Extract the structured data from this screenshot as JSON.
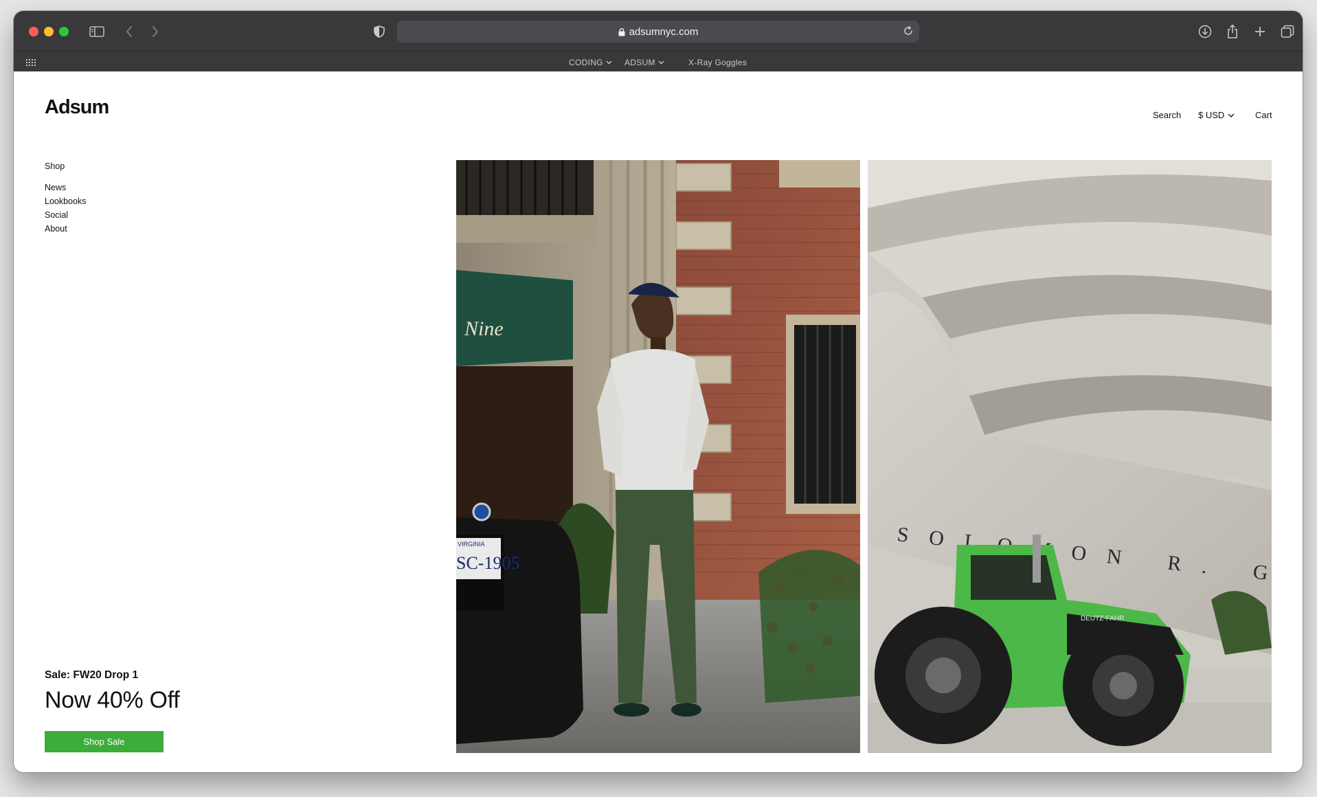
{
  "browser": {
    "url": "adsumnyc.com",
    "favorites": [
      {
        "label": "CODING",
        "has_menu": true
      },
      {
        "label": "ADSUM",
        "has_menu": true
      },
      {
        "label": "X-Ray Goggles",
        "has_menu": false
      }
    ]
  },
  "site": {
    "logo": "Adsum",
    "header": {
      "search": "Search",
      "currency": "$ USD",
      "cart": "Cart"
    },
    "nav": {
      "shop": "Shop",
      "secondary": [
        "News",
        "Lookbooks",
        "Social",
        "About"
      ]
    },
    "promo": {
      "kicker": "Sale: FW20 Drop 1",
      "title": "Now 40% Off",
      "button": "Shop Sale"
    },
    "photos": [
      {
        "name": "lookbook-photo-street-model",
        "plate_text": "SC-1905",
        "plate_state": "VIRGINIA",
        "awning_text": "Nine"
      },
      {
        "name": "lookbook-photo-guggenheim-tractor",
        "building_text": "SOLOMON R. GUGGENHEIM",
        "tractor_text": "DEUTZ-FAHR"
      }
    ]
  },
  "colors": {
    "toolbar": "#39393c",
    "urlbar": "#4b4b4f",
    "accent_green": "#3cac3a",
    "tractor_green": "#4cb848"
  }
}
